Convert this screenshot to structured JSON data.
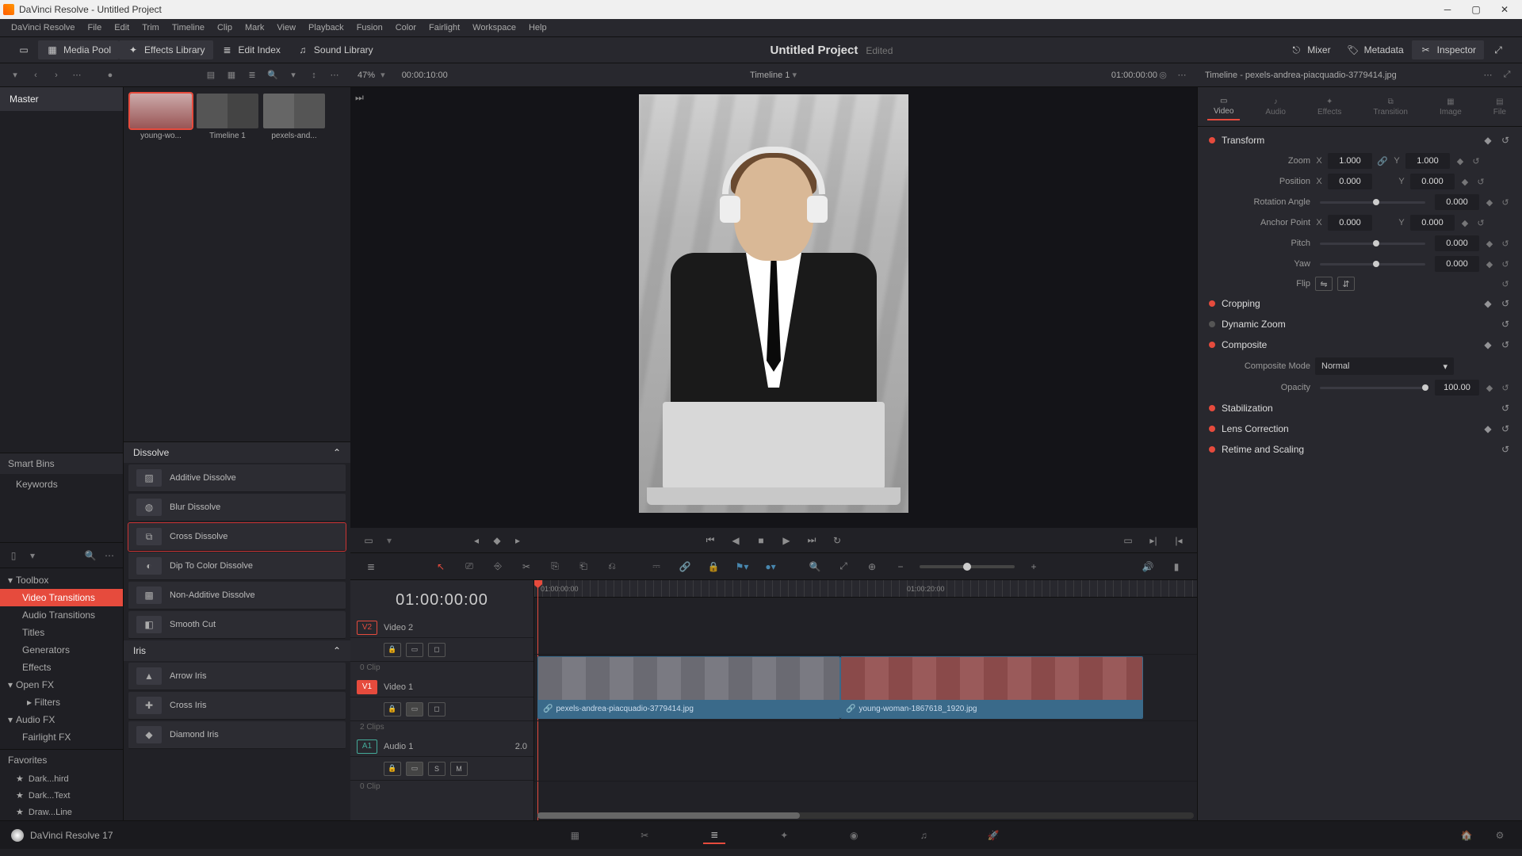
{
  "app": {
    "name": "DaVinci Resolve",
    "project": "Untitled Project",
    "version_footer": "DaVinci Resolve 17"
  },
  "menus": [
    "DaVinci Resolve",
    "File",
    "Edit",
    "Trim",
    "Timeline",
    "Clip",
    "Mark",
    "View",
    "Playback",
    "Fusion",
    "Color",
    "Fairlight",
    "Workspace",
    "Help"
  ],
  "toolbar": {
    "media_pool": "Media Pool",
    "effects_library": "Effects Library",
    "edit_index": "Edit Index",
    "sound_library": "Sound Library",
    "project_title": "Untitled Project",
    "edited": "Edited",
    "mixer": "Mixer",
    "metadata": "Metadata",
    "inspector": "Inspector"
  },
  "subbar": {
    "zoom_pct": "47%",
    "duration_tc": "00:00:10:00",
    "timeline_name": "Timeline 1",
    "position_tc": "01:00:00:00",
    "inspector_title": "Timeline - pexels-andrea-piacquadio-3779414.jpg"
  },
  "bins": {
    "master": "Master",
    "smart_bins_hdr": "Smart Bins",
    "keywords": "Keywords"
  },
  "media_thumbs": [
    {
      "label": "young-wo..."
    },
    {
      "label": "Timeline 1"
    },
    {
      "label": "pexels-and..."
    }
  ],
  "fx_tree": {
    "toolbox": "Toolbox",
    "video_transitions": "Video Transitions",
    "audio_transitions": "Audio Transitions",
    "titles": "Titles",
    "generators": "Generators",
    "effects": "Effects",
    "open_fx": "Open FX",
    "filters": "Filters",
    "audio_fx": "Audio FX",
    "fairlight_fx": "Fairlight FX"
  },
  "favorites": {
    "hdr": "Favorites",
    "items": [
      "Dark...hird",
      "Dark...Text",
      "Draw...Line"
    ]
  },
  "fx_list": {
    "dissolve_hdr": "Dissolve",
    "dissolve": [
      "Additive Dissolve",
      "Blur Dissolve",
      "Cross Dissolve",
      "Dip To Color Dissolve",
      "Non-Additive Dissolve",
      "Smooth Cut"
    ],
    "iris_hdr": "Iris",
    "iris": [
      "Arrow Iris",
      "Cross Iris",
      "Diamond Iris"
    ]
  },
  "timeline": {
    "big_tc": "01:00:00:00",
    "ruler_labels": {
      "l0": "01:00:00:00",
      "l1": "01:00:20:00"
    },
    "tracks": {
      "v2": {
        "tag": "V2",
        "name": "Video 2",
        "clips": "0 Clip"
      },
      "v1": {
        "tag": "V1",
        "name": "Video 1",
        "clips": "2 Clips"
      },
      "a1": {
        "tag": "A1",
        "name": "Audio 1",
        "ch": "2.0",
        "clips": "0 Clip"
      }
    },
    "solo": "S",
    "mute": "M",
    "clips": {
      "c1": "pexels-andrea-piacquadio-3779414.jpg",
      "c2": "young-woman-1867618_1920.jpg"
    }
  },
  "inspector": {
    "tabs": {
      "video": "Video",
      "audio": "Audio",
      "effects": "Effects",
      "transition": "Transition",
      "image": "Image",
      "file": "File"
    },
    "transform": {
      "hdr": "Transform",
      "zoom_lbl": "Zoom",
      "zoom_x": "1.000",
      "zoom_y": "1.000",
      "position_lbl": "Position",
      "pos_x": "0.000",
      "pos_y": "0.000",
      "rotation_lbl": "Rotation Angle",
      "rotation": "0.000",
      "anchor_lbl": "Anchor Point",
      "anchor_x": "0.000",
      "anchor_y": "0.000",
      "pitch_lbl": "Pitch",
      "pitch": "0.000",
      "yaw_lbl": "Yaw",
      "yaw": "0.000",
      "flip_lbl": "Flip"
    },
    "cropping_hdr": "Cropping",
    "dynamic_zoom_hdr": "Dynamic Zoom",
    "composite": {
      "hdr": "Composite",
      "mode_lbl": "Composite Mode",
      "mode_val": "Normal",
      "opacity_lbl": "Opacity",
      "opacity_val": "100.00"
    },
    "stabilization_hdr": "Stabilization",
    "lens_hdr": "Lens Correction",
    "retime_hdr": "Retime and Scaling"
  },
  "xy": {
    "x": "X",
    "y": "Y"
  }
}
